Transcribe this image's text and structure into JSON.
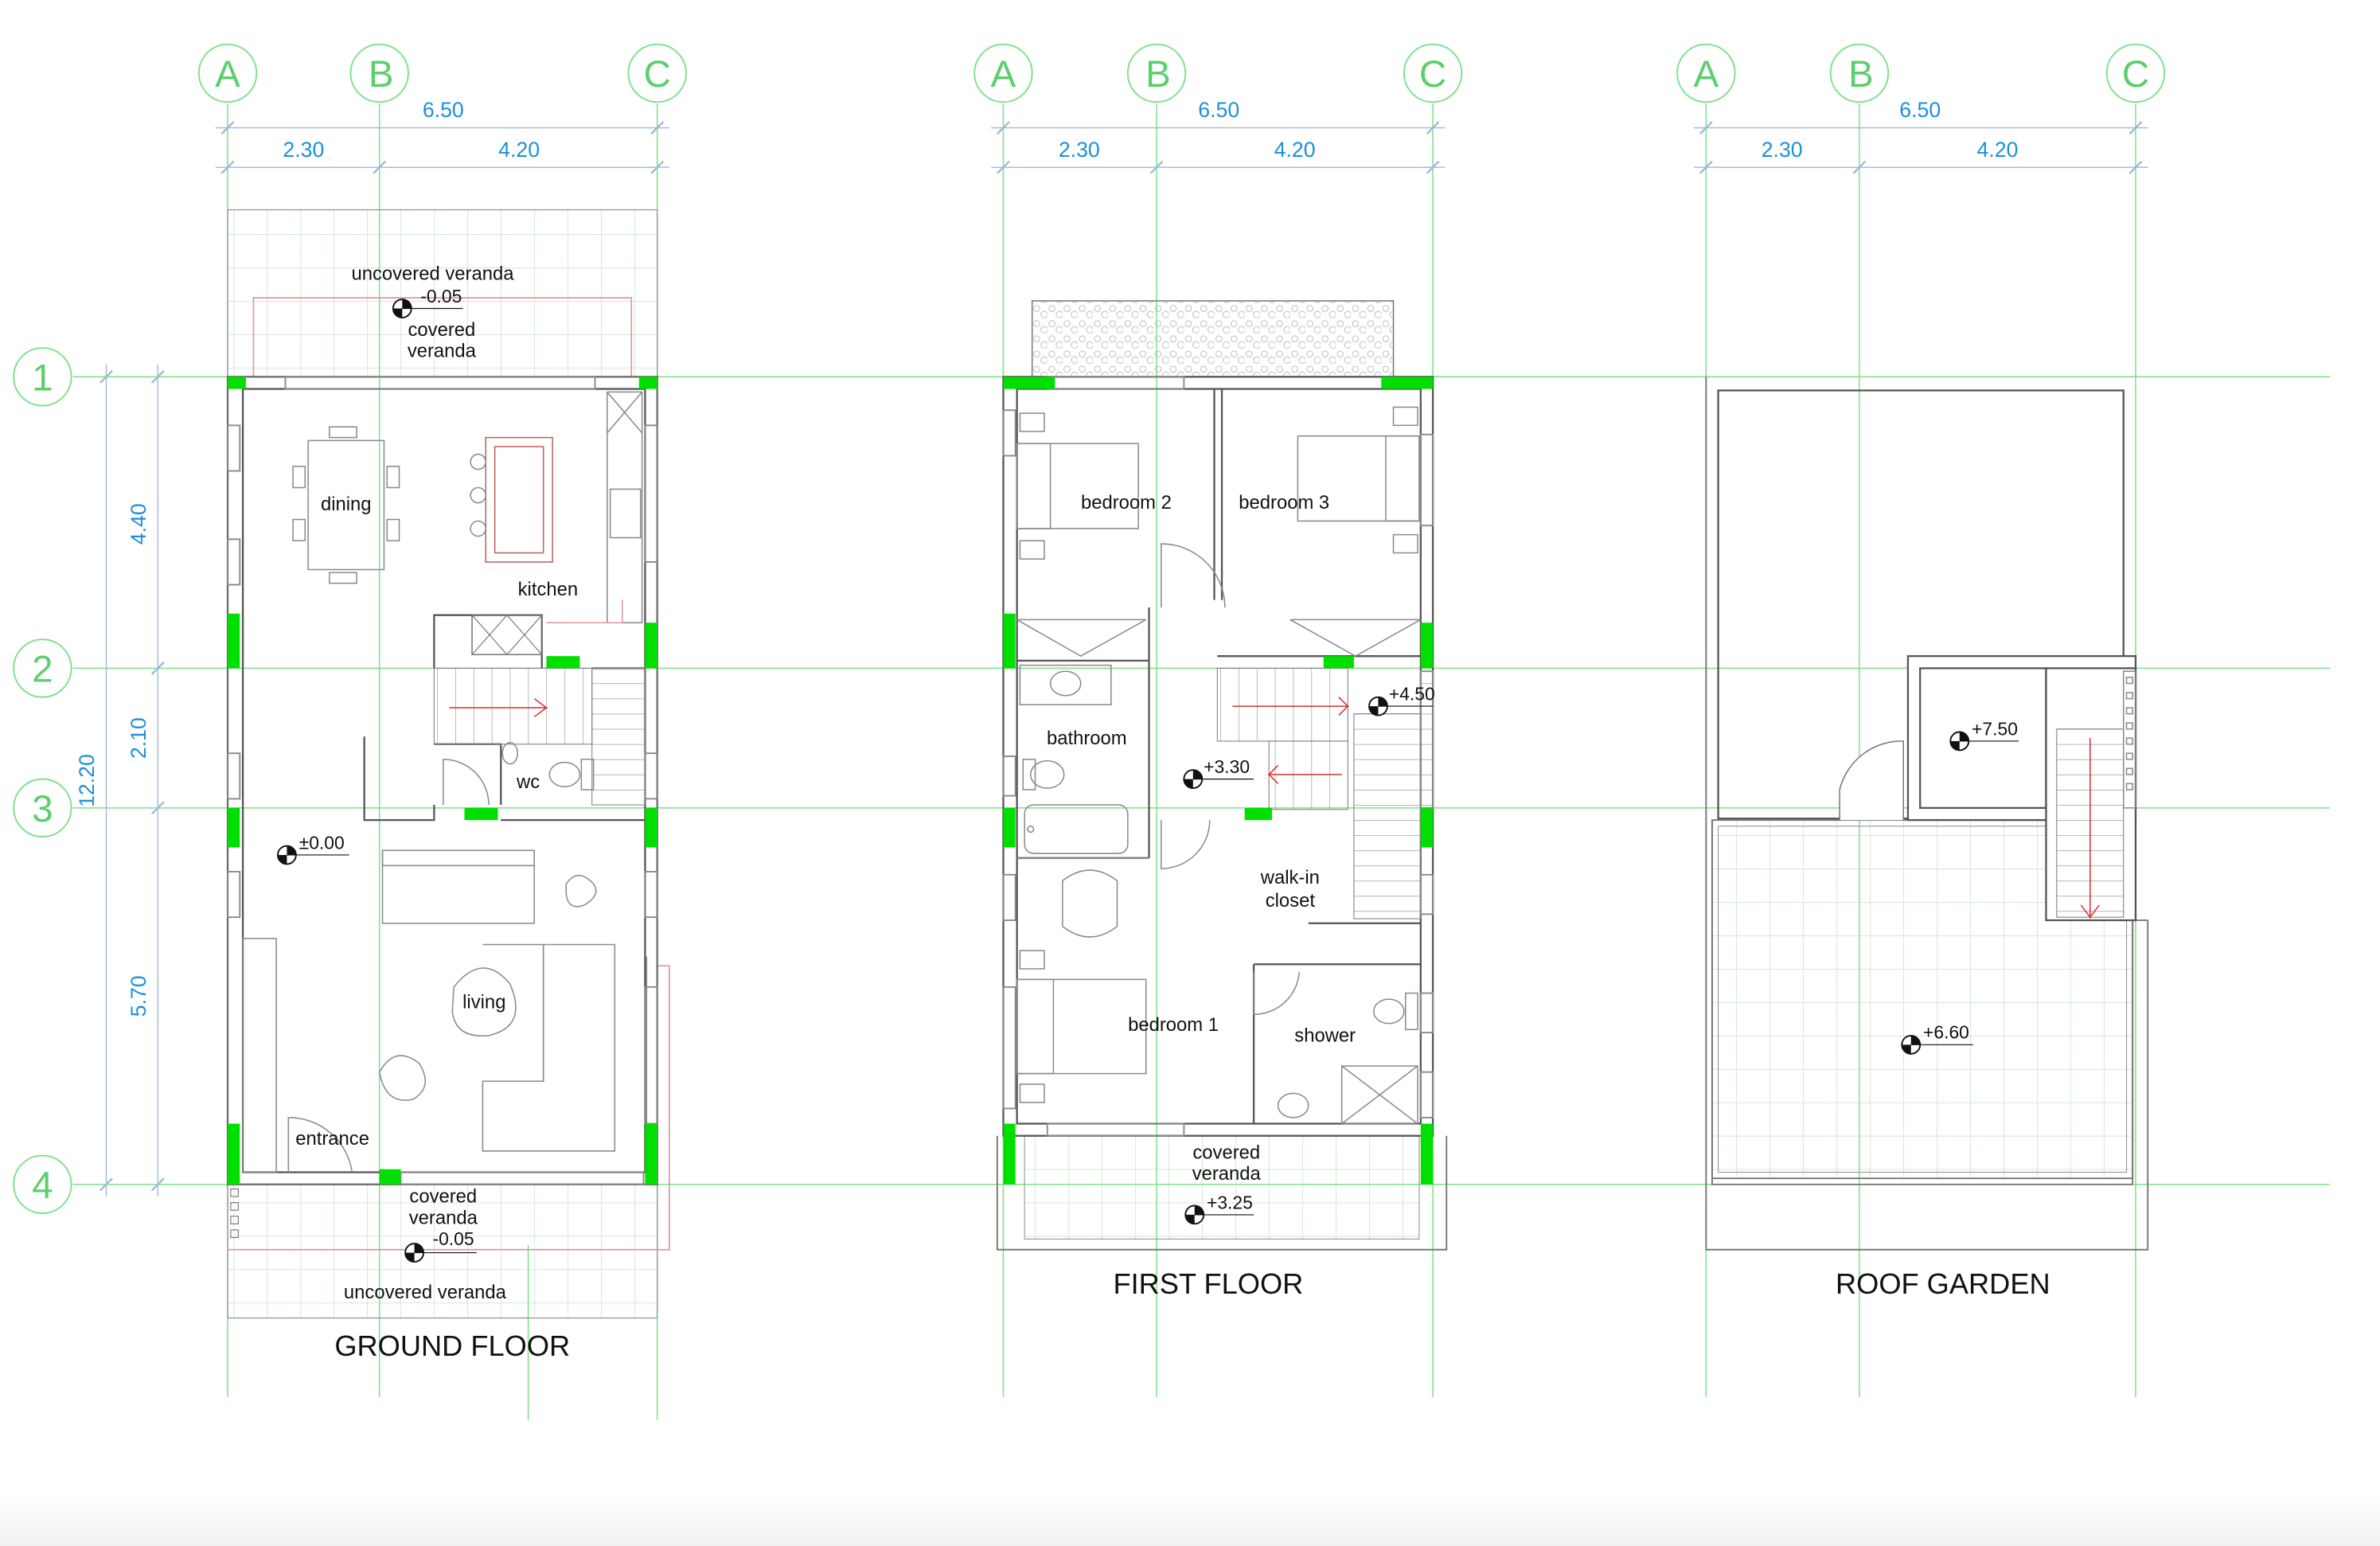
{
  "colors": {
    "grid": "#7fe08c",
    "grid_label": "#5ccf6d",
    "dimension": "#1e8fdc",
    "wall": "#555555",
    "furniture": "#8a8a8a",
    "column": "#00e000",
    "accent_red": "#d63030"
  },
  "grid_axes": {
    "columns": [
      "A",
      "B",
      "C"
    ],
    "rows": [
      "1",
      "2",
      "3",
      "4"
    ]
  },
  "dimensions": {
    "overall_width": "6.50",
    "bay_ab": "2.30",
    "bay_bc": "4.20",
    "overall_depth": "12.20",
    "bay_12": "4.40",
    "bay_23": "2.10",
    "bay_34": "5.70"
  },
  "ground_floor": {
    "title": "GROUND FLOOR",
    "rooms": {
      "dining": "dining",
      "kitchen": "kitchen",
      "wc": "wc",
      "living": "living",
      "entrance": "entrance",
      "uncovered_veranda_top": "uncovered veranda",
      "covered_veranda_top": "covered\nveranda",
      "covered_veranda_bottom": "covered\nveranda",
      "uncovered_veranda_bottom": "uncovered veranda"
    },
    "levels": {
      "veranda_top": "-0.05",
      "living": "±0.00",
      "veranda_bottom": "-0.05"
    }
  },
  "first_floor": {
    "title": "FIRST FLOOR",
    "rooms": {
      "bedroom2": "bedroom 2",
      "bedroom3": "bedroom 3",
      "bathroom": "bathroom",
      "walkin": "walk-in\ncloset",
      "bedroom1": "bedroom 1",
      "shower": "shower",
      "covered_veranda": "covered\nveranda"
    },
    "levels": {
      "landing": "+3.30",
      "stair_top": "+4.50",
      "veranda": "+3.25"
    }
  },
  "roof_garden": {
    "title": "ROOF GARDEN",
    "levels": {
      "stair_room": "+7.50",
      "terrace": "+6.60"
    }
  }
}
